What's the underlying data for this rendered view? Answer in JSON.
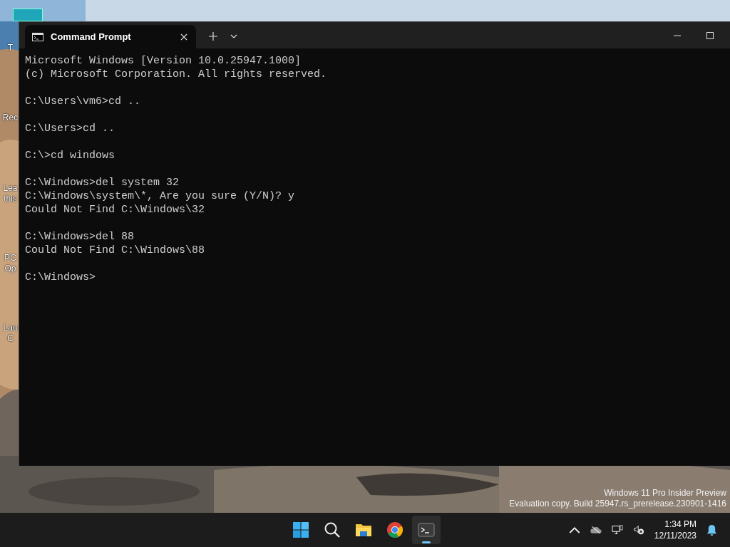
{
  "desktop_icons": [
    {
      "lines": [
        "T"
      ]
    },
    {
      "lines": [
        "Rec"
      ]
    },
    {
      "lines": [
        "Lea",
        "this"
      ]
    },
    {
      "lines": [
        "PC",
        "Op"
      ]
    },
    {
      "lines": [
        "Lau",
        "C"
      ]
    }
  ],
  "window": {
    "tab": {
      "title": "Command Prompt",
      "selected": true
    }
  },
  "console": {
    "blocks": [
      [
        "Microsoft Windows [Version 10.0.25947.1000]",
        "(c) Microsoft Corporation. All rights reserved."
      ],
      [
        "C:\\Users\\vm6>cd .."
      ],
      [
        "C:\\Users>cd .."
      ],
      [
        "C:\\>cd windows"
      ],
      [
        "C:\\Windows>del system 32",
        "C:\\Windows\\system\\*, Are you sure (Y/N)? y",
        "Could Not Find C:\\Windows\\32"
      ],
      [
        "C:\\Windows>del 88",
        "Could Not Find C:\\Windows\\88"
      ],
      [
        "C:\\Windows>"
      ]
    ]
  },
  "watermark": [
    "Windows 11 Pro Insider Preview",
    "Evaluation copy. Build 25947.rs_prerelease.230901-1416"
  ],
  "taskbar": {
    "apps": [
      {
        "kind": "start",
        "active": false
      },
      {
        "kind": "search",
        "active": false
      },
      {
        "kind": "files",
        "active": false
      },
      {
        "kind": "browser",
        "active": false
      },
      {
        "kind": "terminal",
        "active": true
      }
    ],
    "time": "1:34 PM",
    "date": "12/11/2023"
  }
}
